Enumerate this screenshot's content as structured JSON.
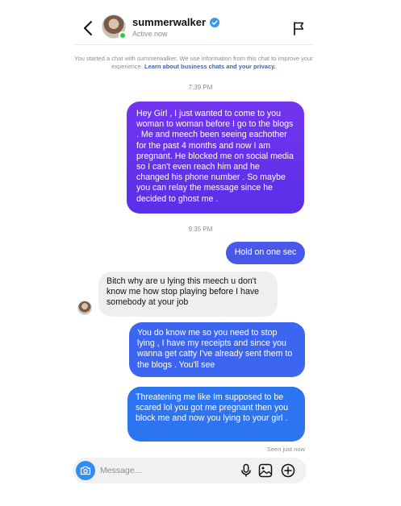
{
  "header": {
    "username": "summerwalker",
    "status": "Active now",
    "verified": true
  },
  "notice": {
    "text": "You started a chat with summerwalker. We use information from this chat to improve your experience.",
    "link": "Learn about business chats and your privacy."
  },
  "timestamps": [
    "7:39 PM",
    "9:35 PM"
  ],
  "messages": [
    {
      "from": "me",
      "text": "Hey Girl , I just wanted to come to you woman to woman before I go to the blogs . Me and meech been seeing eachother for the past 4 months and now I am pregnant. He blocked me on social media so I can't even reach him and he changed his phone number . So maybe you can relay the message since he decided to ghost me ."
    },
    {
      "from": "me",
      "text": "Hold on one sec"
    },
    {
      "from": "them",
      "text": "Bitch why are u lying this meech u don't know me how stop playing before I have somebody at your job"
    },
    {
      "from": "me",
      "text": "You do know me so you need to stop lying , I have my receipts and since you wanna get catty I've already sent them to the blogs . You'll see"
    },
    {
      "from": "me",
      "text": "Threatening me like Im supposed to be scared lol you got me pregnant then you block me and now you lying to your girl ."
    }
  ],
  "seen": "Seen just now",
  "composer": {
    "placeholder": "Message...",
    "value": ""
  },
  "colors": {
    "accent_blue": "#3c66f0",
    "purple": "#6a32ee",
    "verified": "#3897f0",
    "online": "#2ecc40"
  }
}
